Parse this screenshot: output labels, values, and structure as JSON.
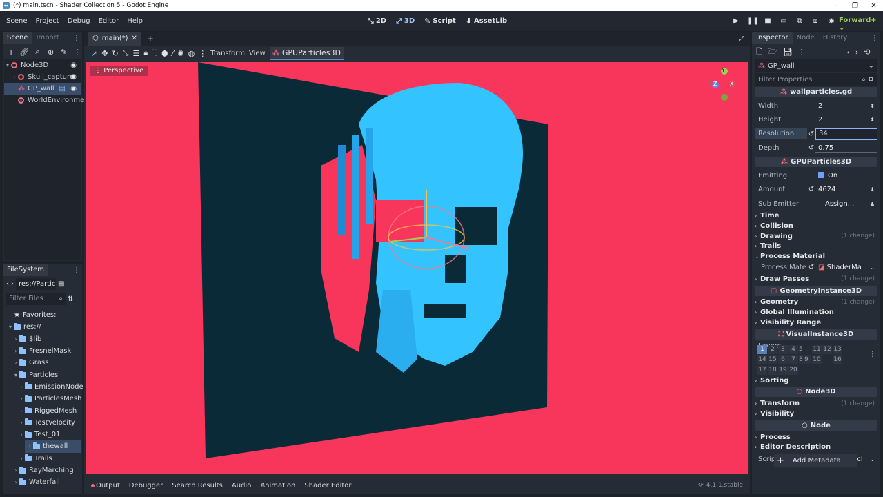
{
  "window": {
    "title": "(*) main.tscn - Shader Collection 5 - Godot Engine",
    "buttons": [
      "–",
      "❐",
      "✕"
    ]
  },
  "menus": [
    "Scene",
    "Project",
    "Debug",
    "Editor",
    "Help"
  ],
  "workspaces": [
    {
      "icon": "⤡",
      "label": "2D"
    },
    {
      "icon": "⤢",
      "label": "3D"
    },
    {
      "icon": "✎",
      "label": "Script"
    },
    {
      "icon": "⬇",
      "label": "AssetLib"
    }
  ],
  "renderer": "Forward+",
  "scene_dock": {
    "tabs": [
      "Scene",
      "Import"
    ],
    "nodes": [
      {
        "name": "Node3D",
        "kind": "node3d",
        "depth": 0
      },
      {
        "name": "Skull_capture",
        "kind": "node3d",
        "depth": 1
      },
      {
        "name": "GP_wall",
        "kind": "particles",
        "depth": 1
      },
      {
        "name": "WorldEnvironment",
        "kind": "world",
        "depth": 1
      }
    ]
  },
  "filesystem": {
    "tab": "FileSystem",
    "path": "res://Particl",
    "filter_placeholder": "Filter Files",
    "items": [
      {
        "label": "Favorites:",
        "type": "fav",
        "indent": 0
      },
      {
        "label": "res://",
        "type": "folder",
        "indent": 0,
        "arrow": "▾"
      },
      {
        "label": "$lib",
        "type": "folder",
        "indent": 1,
        "arrow": "›"
      },
      {
        "label": "FresnelMask",
        "type": "folder",
        "indent": 1,
        "arrow": "›"
      },
      {
        "label": "Grass",
        "type": "folder",
        "indent": 1,
        "arrow": "›"
      },
      {
        "label": "Particles",
        "type": "folder",
        "indent": 1,
        "arrow": "▾"
      },
      {
        "label": "EmissionNode",
        "type": "folder",
        "indent": 2,
        "arrow": "›"
      },
      {
        "label": "ParticlesMesh",
        "type": "folder",
        "indent": 2,
        "arrow": "›"
      },
      {
        "label": "RiggedMesh",
        "type": "folder",
        "indent": 2,
        "arrow": "›"
      },
      {
        "label": "TestVelocity",
        "type": "folder",
        "indent": 2,
        "arrow": "›"
      },
      {
        "label": "Test_01",
        "type": "folder",
        "indent": 2,
        "arrow": "›"
      },
      {
        "label": "thewall",
        "type": "folder",
        "indent": 2,
        "arrow": "›"
      },
      {
        "label": "Trails",
        "type": "folder",
        "indent": 2,
        "arrow": "›"
      },
      {
        "label": "RayMarching",
        "type": "folder",
        "indent": 1,
        "arrow": "›"
      },
      {
        "label": "Waterfall",
        "type": "folder",
        "indent": 1,
        "arrow": "›"
      }
    ]
  },
  "center": {
    "doc_tab": "main(*)",
    "toolbar": {
      "transform": "Transform",
      "view": "View",
      "node": "GPUParticles3D"
    },
    "perspective": "Perspective",
    "gizmo": {
      "y": "Y",
      "x": "X",
      "z": "Z"
    },
    "bottom_tabs": [
      "Output",
      "Debugger",
      "Search Results",
      "Audio",
      "Animation",
      "Shader Editor"
    ],
    "version": "4.1.1.stable",
    "colors": {
      "background": "#f8355a",
      "wall": "#0b2a38",
      "skull": "#33c4ff"
    }
  },
  "inspector": {
    "tabs": [
      "Inspector",
      "Node",
      "History"
    ],
    "object": "GP_wall",
    "filter_placeholder": "Filter Properties",
    "script_section": "wallparticles.gd",
    "width_label": "Width",
    "width_value": "2",
    "height_label": "Height",
    "height_value": "2",
    "resolution_label": "Resolution",
    "resolution_value": "34",
    "depth_label": "Depth",
    "depth_value": "0.75",
    "gpu_section": "GPUParticles3D",
    "emitting_label": "Emitting",
    "emitting_value": "On",
    "amount_label": "Amount",
    "amount_value": "4624",
    "subemitter_label": "Sub Emitter",
    "subemitter_value": "Assign...",
    "groups1": [
      {
        "label": "Time",
        "change": ""
      },
      {
        "label": "Collision",
        "change": ""
      },
      {
        "label": "Drawing",
        "change": "(1 change)"
      },
      {
        "label": "Trails",
        "change": ""
      },
      {
        "label": "Process Material",
        "change": "",
        "open": true
      }
    ],
    "process_mat_label": "Process Mate...",
    "process_mat_value": "ShaderMa",
    "drawpasses": {
      "label": "Draw Passes",
      "change": "(1 change)"
    },
    "geom_section": "GeometryInstance3D",
    "groups2": [
      {
        "label": "Geometry",
        "change": "(1 change)"
      },
      {
        "label": "Global Illumination",
        "change": ""
      },
      {
        "label": "Visibility Range",
        "change": ""
      }
    ],
    "visual_section": "VisualInstance3D",
    "layers_label": "Layers",
    "layers": [
      "1",
      "2",
      "3",
      "4",
      "5",
      "11",
      "12",
      "13",
      "14",
      "15",
      "6",
      "7",
      "8",
      "9",
      "10",
      "16",
      "17",
      "18",
      "19",
      "20"
    ],
    "sorting": "Sorting",
    "node3d_section": "Node3D",
    "transform": {
      "label": "Transform",
      "change": "(1 change)"
    },
    "visibility": "Visibility",
    "node_section": "Node",
    "process": "Process",
    "editor_desc": "Editor Description",
    "script_label": "Script",
    "script_value": "wallparticl",
    "add_metadata": "Add Metadata"
  }
}
